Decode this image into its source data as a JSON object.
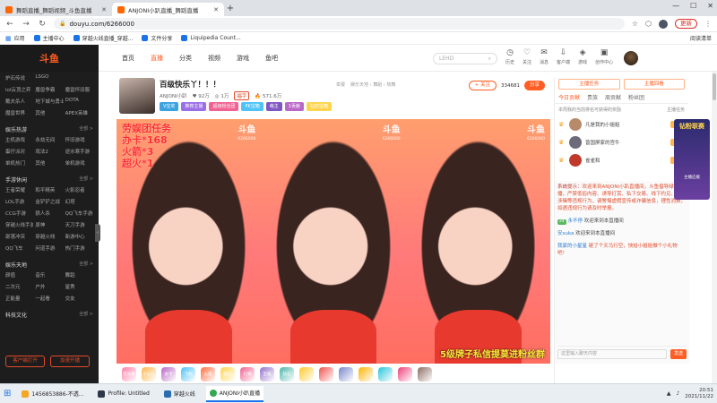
{
  "browser": {
    "tabs": [
      {
        "title": "舞蹈直播_舞蹈视频_斗鱼直播",
        "active": false
      },
      {
        "title": "ANJONI小趴直播_舞蹈直播",
        "active": true
      }
    ],
    "url": "douyu.com/6266000",
    "update_label": "更新",
    "bookmarks": [
      "应用",
      "主播中心",
      "穿越火线直播_穿越...",
      "文件分享",
      "Liquipedia Count..."
    ],
    "reading_list": "阅读清单"
  },
  "site": {
    "logo": "斗鱼",
    "nav": [
      "首页",
      "直播",
      "分类",
      "视频",
      "游戏",
      "鱼吧"
    ],
    "search_placeholder": "LEHD",
    "header_icons": [
      {
        "icon": "history-icon",
        "label": "历史"
      },
      {
        "icon": "heart-icon",
        "label": "关注"
      },
      {
        "icon": "mail-icon",
        "label": "消息"
      },
      {
        "icon": "download-icon",
        "label": "客户端"
      },
      {
        "icon": "game-icon",
        "label": "游戏"
      },
      {
        "icon": "video-icon",
        "label": "创作中心"
      }
    ]
  },
  "sidebar": {
    "sections": [
      {
        "title": "",
        "items": [
          "炉石传说",
          "LSGO",
          "",
          "lol云顶之弈",
          "魔兽争霸",
          "魔兽怀旧服",
          "戴夫杀人",
          "地下城与勇士",
          "DOTA",
          "魔兽世界",
          "其他",
          "APEX英雄"
        ]
      },
      {
        "title": "娱乐热游",
        "more": "全部 >",
        "items": [
          "主机游戏",
          "永劫无间",
          "怀旧游戏",
          "蛋仔派对",
          "戏法2",
          "逆水寒手游",
          "单机热门",
          "其他",
          "单机游戏"
        ]
      },
      {
        "title": "手游休闲",
        "more": "全部 >",
        "items": [
          "王者荣耀",
          "和平精英",
          "火影忍者",
          "LOL手游",
          "金铲铲之战",
          "幻塔",
          "CCG手游",
          "狼人杀",
          "QQ飞车手游",
          "穿越火线手游",
          "原神",
          "天刀手游",
          "部落冲突",
          "穿越火线",
          "新游中心",
          "QQ飞车",
          "问道手游",
          "热门手游"
        ]
      },
      {
        "title": "娱乐天地",
        "more": "全部 >",
        "items": [
          "颜值",
          "音乐",
          "舞蹈",
          "二次元",
          "户外",
          "星秀",
          "正能量",
          "一起看",
          "交友"
        ]
      },
      {
        "title": "科技文化",
        "more": "全部 >",
        "items": []
      }
    ],
    "buttons": [
      "客户端打开",
      "加速开播"
    ]
  },
  "room": {
    "title": "百级快乐丫！！！",
    "streamer": "ANJONI小趴",
    "meta": [
      "举报",
      "娱乐天地 › 舞蹈 › 热舞"
    ],
    "stats": [
      "92万",
      "1万",
      "571.6万"
    ],
    "hot_tag": "福字",
    "tags": [
      {
        "label": "V宝奖",
        "color": "#3aa3e0"
      },
      {
        "label": "推荐主播",
        "color": "#9a6ee6"
      },
      {
        "label": "超级粉丝团",
        "color": "#f06292"
      },
      {
        "label": "PK宝箱",
        "color": "#4fc3f7"
      },
      {
        "label": "萌主",
        "color": "#7e57c2"
      },
      {
        "label": "1贡献",
        "color": "#ba68c8"
      },
      {
        "label": "钻石宝箱",
        "color": "#ffd54f"
      }
    ],
    "follow_label": "+ 关注",
    "follower_count": "334681",
    "report_label": "分享"
  },
  "video": {
    "overlay_lines": [
      "劳娱团任务",
      "办卡*168",
      "火箭*3",
      "超火*1"
    ],
    "watermark": "斗鱼",
    "watermark_sub": "6266000",
    "bottom_text": "5级牌子私信提莫进粉丝群"
  },
  "gifts": [
    "荧光棒",
    "小心心",
    "办卡",
    "飞机",
    "火箭",
    "超火",
    "礼物",
    "宝箱",
    "钻石",
    "",
    "",
    "",
    "",
    "",
    "",
    ""
  ],
  "right_panel": {
    "buttons": [
      "主播任务",
      "主播回看"
    ],
    "tabs": [
      "今日贡献",
      "贵族",
      "周贡献",
      "粉丝团"
    ],
    "rank_header": "本周我的当前排名可获得的奖励",
    "rank_header_more": "主播任务",
    "ranks": [
      {
        "name": "凡是我的小姐姐"
      },
      {
        "name": "曾国屏家的宫牛"
      },
      {
        "name": "雀雀和"
      }
    ],
    "system_msg_label": "系统提示：",
    "system_msg": "欢迎来到ANJONI小趴直播间，斗鱼倡导绿色直播，严禁低俗内容、诱导打赏、私下交易、线下约见、涉黄涉赌等违规行为，请警惕虚假宣传或诈骗信息，理性消费，如遇违规行为请及时举报。",
    "messages": [
      {
        "level": "24",
        "user": "永不停",
        "text": "欢迎来到本直播间"
      },
      {
        "level": "",
        "user": "安suka",
        "text": "欢迎来到本直播间"
      },
      {
        "level": "",
        "user": "我家的小星星",
        "text": "砸了个天马行空，快给小姐姐做个小礼物吧！"
      }
    ],
    "input_placeholder": "这里输入聊天内容",
    "send_label": "发送",
    "promo_title": "钻粉联赛",
    "promo_sub": "主播应援"
  },
  "taskbar": {
    "items": [
      "1456853886-不透...",
      "Profile: Untitled",
      "穿越火线",
      "ANJONI小趴直播"
    ],
    "time": "20:51",
    "date": "2021/11/22"
  },
  "colors": {
    "accent": "#ff5d23",
    "sidebar": "#1d1d1d"
  }
}
